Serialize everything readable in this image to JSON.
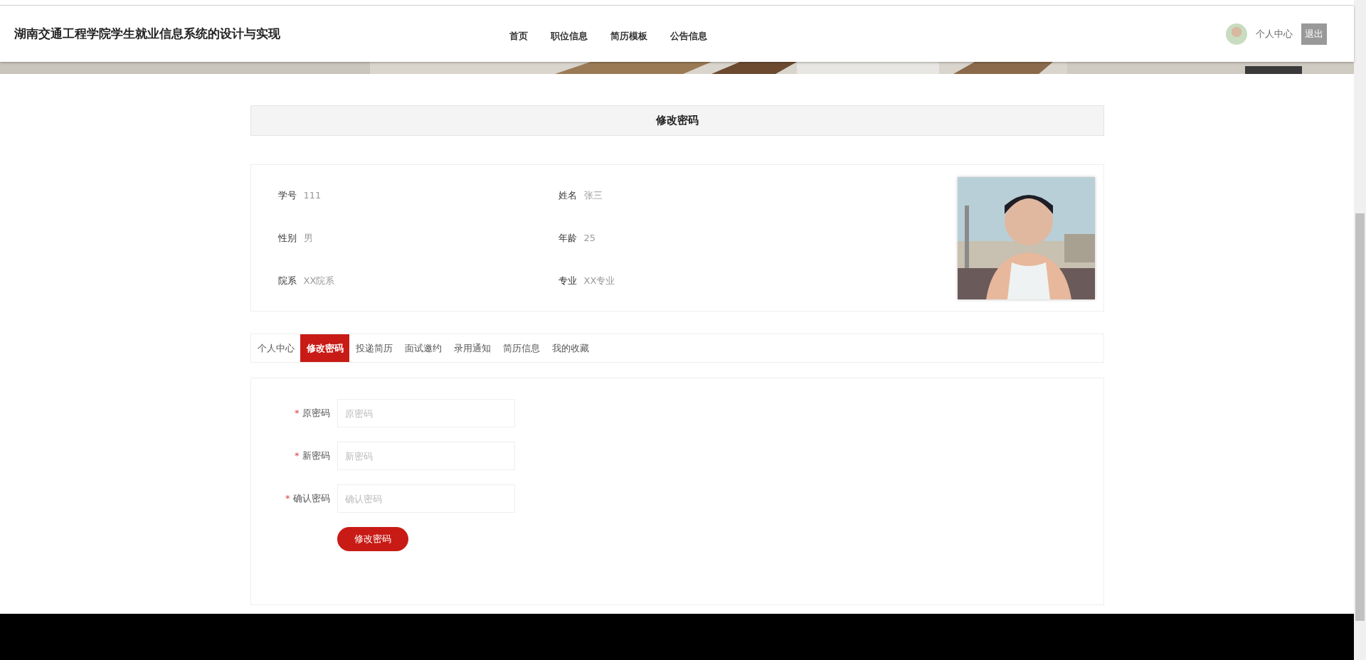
{
  "header": {
    "site_title": "湖南交通工程学院学生就业信息系统的设计与实现",
    "nav": [
      {
        "label": "首页"
      },
      {
        "label": "职位信息"
      },
      {
        "label": "简历模板"
      },
      {
        "label": "公告信息"
      }
    ],
    "user_link": "个人中心",
    "logout": "退出"
  },
  "page_heading": "修改密码",
  "profile": {
    "fields": [
      {
        "label": "学号",
        "value": "111"
      },
      {
        "label": "姓名",
        "value": "张三"
      },
      {
        "label": "性别",
        "value": "男"
      },
      {
        "label": "年龄",
        "value": "25"
      },
      {
        "label": "院系",
        "value": "XX院系"
      },
      {
        "label": "专业",
        "value": "XX专业"
      }
    ]
  },
  "tabs": [
    {
      "label": "个人中心",
      "selected": false
    },
    {
      "label": "修改密码",
      "selected": true
    },
    {
      "label": "投递简历",
      "selected": false
    },
    {
      "label": "面试邀约",
      "selected": false
    },
    {
      "label": "录用通知",
      "selected": false
    },
    {
      "label": "简历信息",
      "selected": false
    },
    {
      "label": "我的收藏",
      "selected": false
    }
  ],
  "form": {
    "fields": [
      {
        "mark": "*",
        "label": "原密码",
        "placeholder": "原密码"
      },
      {
        "mark": "*",
        "label": "新密码",
        "placeholder": "新密码"
      },
      {
        "mark": "*",
        "label": "确认密码",
        "placeholder": "确认密码"
      }
    ],
    "submit": "修改密码"
  }
}
